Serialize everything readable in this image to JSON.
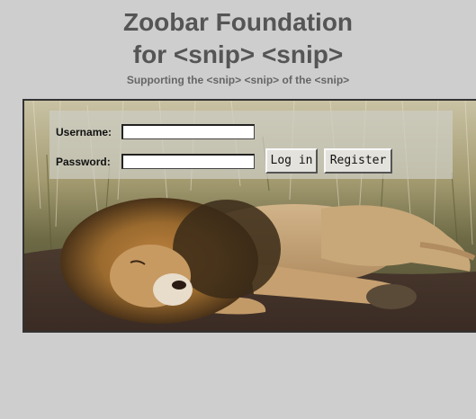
{
  "header": {
    "title_line1": "Zoobar Foundation",
    "title_line2": "for <snip> <snip>",
    "subtitle": "Supporting the <snip> <snip> of the <snip>"
  },
  "login": {
    "username_label": "Username:",
    "username_value": "",
    "password_label": "Password:",
    "password_value": "",
    "login_button": "Log in",
    "register_button": "Register"
  },
  "photo": {
    "subject": "sleeping-lion-image"
  }
}
